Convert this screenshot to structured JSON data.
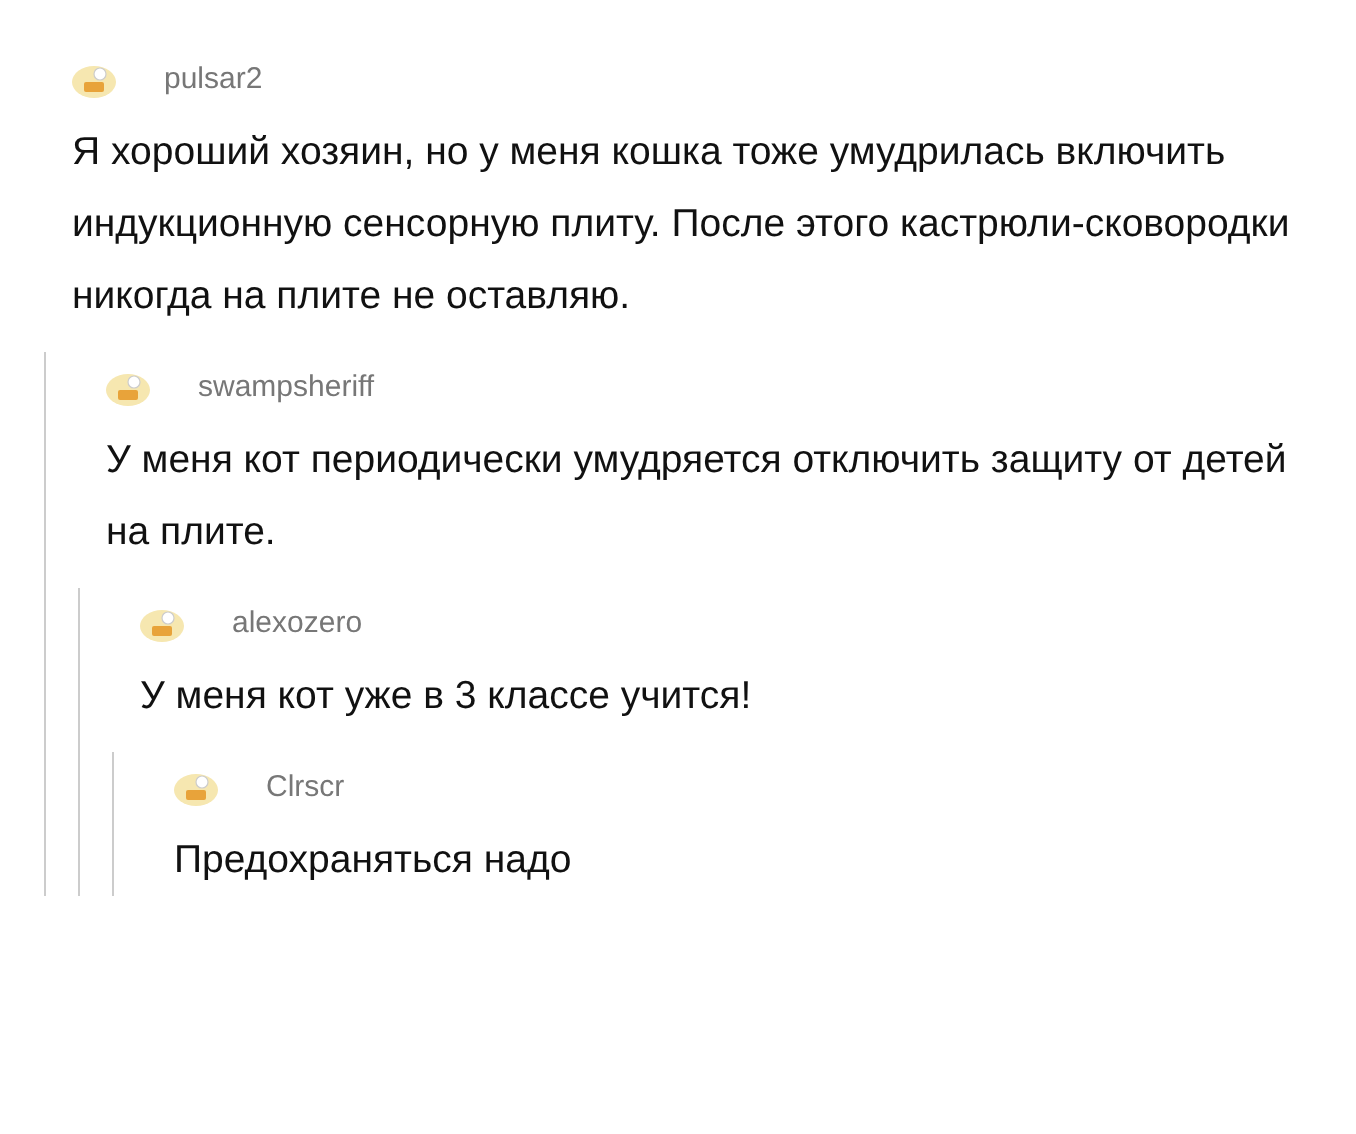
{
  "comments": [
    {
      "username": "pulsar2",
      "text": "Я хороший хозяин, но у меня кошка тоже умудрилась включить индукционную сенсорную плиту. После этого кастрюли-сковородки никогда на плите не оставляю.",
      "children": [
        {
          "username": "swampsheriff",
          "text": "У меня кот периодически умудряется отключить защиту от детей на плите.",
          "children": [
            {
              "username": "alexozero",
              "text": "У меня кот уже в 3 классе учится!",
              "children": [
                {
                  "username": "Clrscr",
                  "text": "Предохраняться надо"
                }
              ]
            }
          ]
        }
      ]
    }
  ]
}
